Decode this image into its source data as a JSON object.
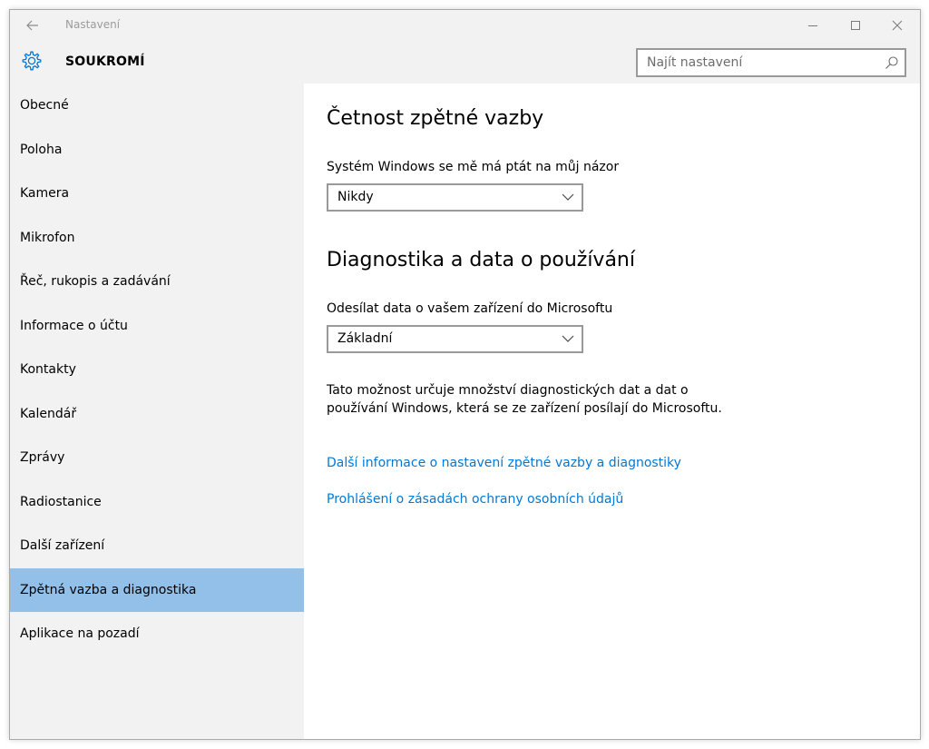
{
  "window": {
    "app_title": "Nastavení",
    "section_title": "SOUKROMÍ",
    "controls": {
      "minimize_icon": "minimize-icon",
      "maximize_icon": "maximize-icon",
      "close_icon": "close-icon"
    },
    "back_icon": "back-arrow-icon"
  },
  "search": {
    "placeholder": "Najít nastavení",
    "icon": "search-icon"
  },
  "sidebar": {
    "selected_index": 11,
    "items": [
      {
        "label": "Obecné"
      },
      {
        "label": "Poloha"
      },
      {
        "label": "Kamera"
      },
      {
        "label": "Mikrofon"
      },
      {
        "label": "Řeč, rukopis a zadávání"
      },
      {
        "label": "Informace o účtu"
      },
      {
        "label": "Kontakty"
      },
      {
        "label": "Kalendář"
      },
      {
        "label": "Zprávy"
      },
      {
        "label": "Radiostanice"
      },
      {
        "label": "Další zařízení"
      },
      {
        "label": "Zpětná vazba a diagnostika"
      },
      {
        "label": "Aplikace na pozadí"
      }
    ]
  },
  "main": {
    "feedback": {
      "heading": "Četnost zpětné vazby",
      "label": "Systém Windows se mě má ptát na můj názor",
      "selected_value": "Nikdy"
    },
    "diagnostics": {
      "heading": "Diagnostika a data o používání",
      "label": "Odesílat data o vašem zařízení do Microsoftu",
      "selected_value": "Základní",
      "description": "Tato možnost určuje množství diagnostických dat a dat o používání Windows, která se ze zařízení posílají do Microsoftu."
    },
    "links": [
      {
        "label": "Další informace o nastavení zpětné vazby a diagnostiky"
      },
      {
        "label": "Prohlášení o zásadách ochrany osobních údajů"
      }
    ]
  },
  "colors": {
    "accent": "#0078d7",
    "selection": "#92c0e8",
    "chrome": "#f2f2f2"
  }
}
